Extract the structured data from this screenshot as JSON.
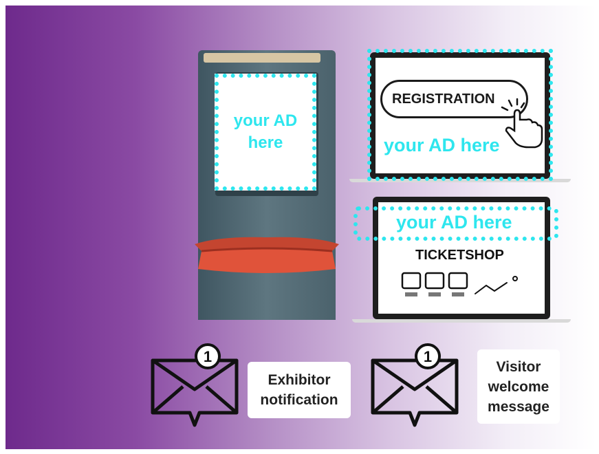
{
  "kiosk": {
    "ad_text": "your AD\nhere"
  },
  "laptop_registration": {
    "button_label": "REGISTRATION",
    "ad_text": "your AD here"
  },
  "laptop_ticketshop": {
    "ad_text": "your AD here",
    "title": "TICKETSHOP"
  },
  "notifications": [
    {
      "badge": "1",
      "label": "Exhibitor\nnotification"
    },
    {
      "badge": "1",
      "label": "Visitor\nwelcome\nmessage"
    }
  ],
  "colors": {
    "accent_dotted": "#2ee6ee",
    "kiosk_body": "#4f6671",
    "slot": "#e0533a",
    "purple": "#6e2a8c"
  },
  "icons": [
    "cursor-hand-icon",
    "monitor-icon",
    "chart-line-icon",
    "envelope-icon"
  ]
}
